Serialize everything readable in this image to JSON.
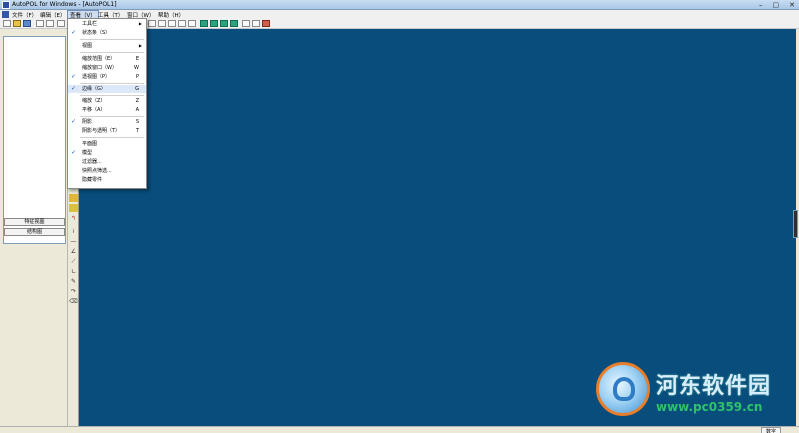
{
  "window": {
    "title": "AutoPOL for Windows - [AutoPOL1]"
  },
  "menubar": {
    "items": [
      "文件（F）",
      "编辑（E）",
      "查看（V）",
      "工具（T）",
      "窗口（W）",
      "帮助（H）"
    ],
    "active": "查看（V）"
  },
  "view_menu": {
    "items": [
      {
        "label": "工具栏",
        "key": "",
        "checked": false,
        "submenu": true
      },
      {
        "label": "状态条（S）",
        "key": "",
        "checked": true,
        "submenu": false
      },
      {
        "label": "视图",
        "key": "",
        "checked": false,
        "submenu": true
      },
      {
        "label": "缩放范围（E）",
        "key": "E",
        "checked": false,
        "submenu": false
      },
      {
        "label": "缩放窗口（W）",
        "key": "W",
        "checked": false,
        "submenu": false
      },
      {
        "label": "透视图（P）",
        "key": "P",
        "checked": true,
        "submenu": false
      },
      {
        "label": "边缘（G）",
        "key": "G",
        "checked": true,
        "submenu": false
      },
      {
        "label": "缩放（Z）",
        "key": "Z",
        "checked": false,
        "submenu": false
      },
      {
        "label": "平移（A）",
        "key": "A",
        "checked": false,
        "submenu": false
      },
      {
        "label": "阴影",
        "key": "S",
        "checked": true,
        "submenu": false
      },
      {
        "label": "阴影与透明（T）",
        "key": "T",
        "checked": false,
        "submenu": false
      },
      {
        "label": "平面图",
        "key": "",
        "checked": false,
        "submenu": false
      },
      {
        "label": "模型",
        "key": "",
        "checked": true,
        "submenu": false
      },
      {
        "label": "过滤器...",
        "key": "",
        "checked": false,
        "submenu": false
      },
      {
        "label": "快照点筛选...",
        "key": "",
        "checked": false,
        "submenu": false
      },
      {
        "label": "隐藏零件",
        "key": "",
        "checked": false,
        "submenu": false
      }
    ]
  },
  "left_panel": {
    "button1": "特征视图",
    "button2": "结构图"
  },
  "statusbar": {
    "mode": "数字"
  },
  "watermark": {
    "title": "河东软件园",
    "url": "www.pc0359.cn"
  },
  "colors": {
    "canvas": "#084d7b",
    "accent": "#1b54b7"
  }
}
